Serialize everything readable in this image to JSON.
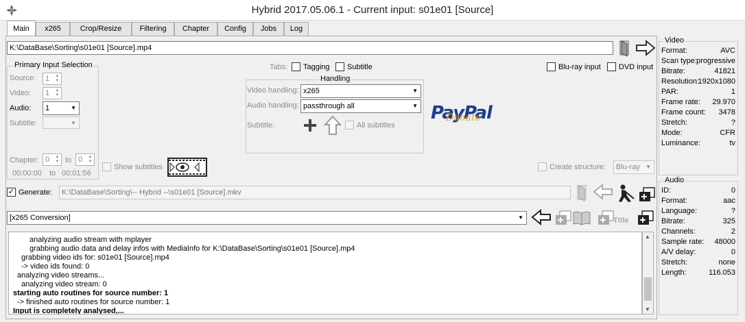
{
  "window": {
    "title": "Hybrid 2017.05.06.1 - Current input: s01e01 [Source]"
  },
  "tabs": [
    "Main",
    "x265",
    "Crop/Resize",
    "Filtering",
    "Chapter",
    "Config",
    "Jobs",
    "Log"
  ],
  "input_path": "K:\\DataBase\\Sorting\\s01e01 [Source].mp4",
  "primary": {
    "title": "Primary Input Selection",
    "source_label": "Source:",
    "source_value": "1",
    "video_label": "Video:",
    "video_value": "1",
    "audio_label": "Audio:",
    "audio_value": "1",
    "subtitle_label": "Subtitle:",
    "chapter_label": "Chapter:",
    "chapter_from": "0",
    "to_label": "to",
    "chapter_to": "0",
    "time_from": "00:00:00",
    "time_to_label": "to",
    "time_to": "00:01:56"
  },
  "show_subtitles": "Show subtitles",
  "tabs_row": {
    "label": "Tabs:",
    "tagging": "Tagging",
    "subtitle": "Subtitle"
  },
  "handling": {
    "title": "Handling",
    "video_label": "Video handling:",
    "video_value": "x265",
    "audio_label": "Audio handling:",
    "audio_value": "passthrough all",
    "subtitle_label": "Subtitle:",
    "all_subtitles": "All subtitles"
  },
  "paypal": {
    "main": "PayPal",
    "sub": "Donate"
  },
  "bluray_input": "Blu-ray input",
  "dvd_input": "DVD input",
  "create_structure": {
    "label": "Create structure:",
    "value": "Blu-ray"
  },
  "generate": {
    "label": "Generate:",
    "path": "K:\\DataBase\\Sorting\\-- Hybrid --\\s01e01 [Source].mkv"
  },
  "conversion": {
    "value": "[x265 Conversion]",
    "title_label": "Title"
  },
  "log_lines": [
    {
      "text": "analyzing audio stream with mplayer",
      "indent": 8,
      "bold": false
    },
    {
      "text": "grabbing audio data and delay infos with MediaInfo for K:\\DataBase\\Sorting\\s01e01 [Source].mp4",
      "indent": 8,
      "bold": false
    },
    {
      "text": "grabbing video ids for: s01e01 [Source].mp4",
      "indent": 4,
      "bold": false
    },
    {
      "text": "-> video ids found: 0",
      "indent": 4,
      "bold": false
    },
    {
      "text": "analyzing video streams...",
      "indent": 2,
      "bold": false
    },
    {
      "text": "analyzing video stream: 0",
      "indent": 4,
      "bold": false
    },
    {
      "text": "starting auto routines for source number: 1",
      "indent": 0,
      "bold": true
    },
    {
      "text": "-> finished auto routines for source number: 1",
      "indent": 2,
      "bold": false
    },
    {
      "text": "Input is completely analysed,...",
      "indent": 0,
      "bold": true
    }
  ],
  "video_info": {
    "title": "Video",
    "rows": [
      {
        "k": "Format:",
        "v": "AVC"
      },
      {
        "k": "Scan type:",
        "v": "progressive"
      },
      {
        "k": "Bitrate:",
        "v": "41821"
      },
      {
        "k": "Resolution:",
        "v": "1920x1080"
      },
      {
        "k": "PAR:",
        "v": "1"
      },
      {
        "k": "Frame rate:",
        "v": "29.970"
      },
      {
        "k": "Frame count:",
        "v": "3478"
      },
      {
        "k": "Stretch:",
        "v": "?"
      },
      {
        "k": "Mode:",
        "v": "CFR"
      },
      {
        "k": "Luminance:",
        "v": "tv"
      }
    ]
  },
  "audio_info": {
    "title": "Audio",
    "rows": [
      {
        "k": "ID:",
        "v": "0"
      },
      {
        "k": "Format:",
        "v": "aac"
      },
      {
        "k": "Language:",
        "v": "?"
      },
      {
        "k": "Bitrate:",
        "v": "325"
      },
      {
        "k": "Channels:",
        "v": "2"
      },
      {
        "k": "Sample rate:",
        "v": "48000"
      },
      {
        "k": "A/V delay:",
        "v": "0"
      },
      {
        "k": "Stretch:",
        "v": "none"
      },
      {
        "k": "Length:",
        "v": "116.053"
      }
    ]
  }
}
